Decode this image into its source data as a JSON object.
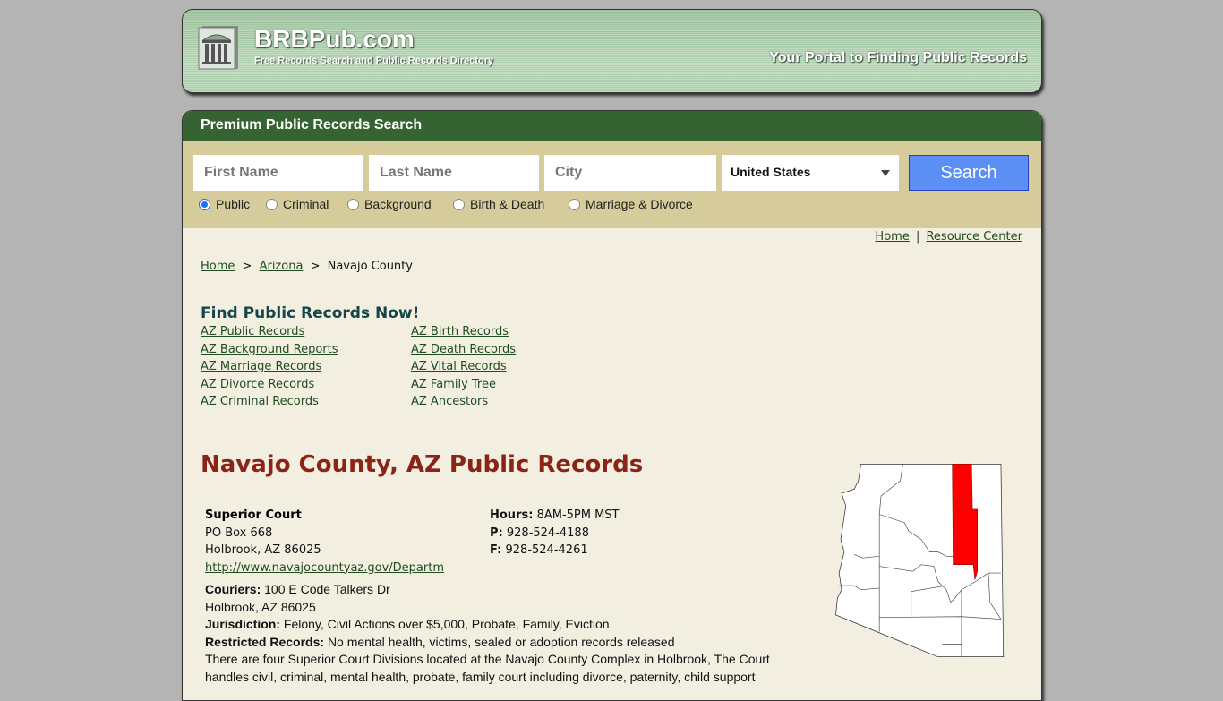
{
  "header": {
    "logo_icon": "courthouse-icon",
    "site_name": "BRBPub.com",
    "tagline": "Free Records Search and Public Records Directory",
    "slogan": "Your Portal to Finding Public Records"
  },
  "search": {
    "title": "Premium Public Records Search",
    "first_name_placeholder": "First Name",
    "last_name_placeholder": "Last Name",
    "city_placeholder": "City",
    "country_selected": "United States",
    "search_label": "Search",
    "record_types": [
      {
        "label": "Public",
        "checked": true
      },
      {
        "label": "Criminal",
        "checked": false
      },
      {
        "label": "Background",
        "checked": false
      },
      {
        "label": "Birth & Death",
        "checked": false
      },
      {
        "label": "Marriage & Divorce",
        "checked": false
      }
    ],
    "colors": {
      "title_bar": "#356332",
      "panel": "#d6cb9a",
      "button": "#5b8ff3"
    }
  },
  "top_links": {
    "home": "Home",
    "separator": "|",
    "resource_center": "Resource Center"
  },
  "breadcrumb": {
    "home": "Home",
    "sep": ">",
    "state": "Arizona",
    "current": "Navajo County"
  },
  "find_records": {
    "title": "Find Public Records Now!",
    "left": [
      "AZ Public Records",
      "AZ Background Reports",
      "AZ Marriage Records",
      "AZ Divorce Records",
      "AZ Criminal Records"
    ],
    "right": [
      "AZ Birth Records",
      "AZ Death Records",
      "AZ Vital Records",
      "AZ Family Tree",
      "AZ Ancestors"
    ]
  },
  "county": {
    "title": "Navajo County, AZ Public Records",
    "court_name": "Superior Court",
    "address1": "PO Box 668",
    "address2": "Holbrook, AZ 86025",
    "website": "http://www.navajocountyaz.gov/Departm",
    "hours_label": "Hours:",
    "hours": "8AM-5PM MST",
    "phone_label": "P:",
    "phone": "928-524-4188",
    "fax_label": "F:",
    "fax": "928-524-4261",
    "couriers_label": "Couriers:",
    "couriers1": "100 E Code Talkers Dr",
    "couriers2": "Holbrook, AZ 86025",
    "jurisdiction_label": "Jurisdiction:",
    "jurisdiction": "Felony, Civil Actions over $5,000, Probate, Family, Eviction",
    "restricted_label": "Restricted Records:",
    "restricted": "No mental health, victims, sealed or adoption records released",
    "description": "There are four Superior Court Divisions located at the Navajo County Complex in Holbrook, The Court handles civil, criminal, mental health, probate, family court including divorce, paternity, child support",
    "map_icon": "arizona-county-map",
    "highlight_color": "#ff0000",
    "title_color": "#8b2317"
  }
}
